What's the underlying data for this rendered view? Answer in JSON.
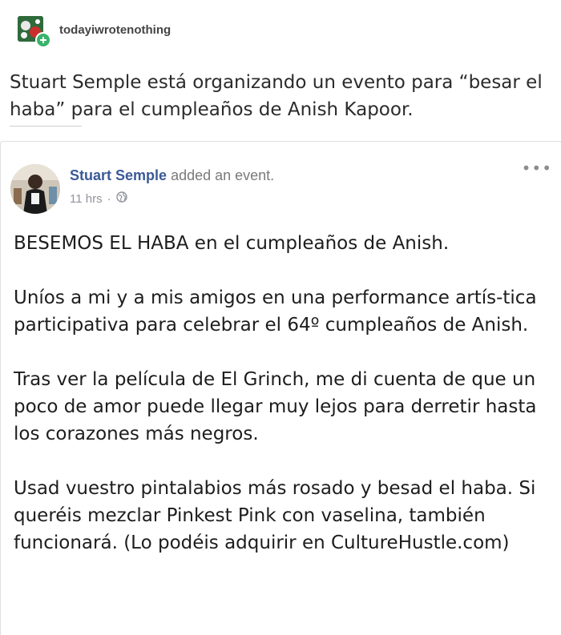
{
  "tumblr": {
    "username": "todayiwrotenothing",
    "caption": "Stuart Semple está organizando un evento para “besar el haba” para el cumpleaños de Anish Kapoor."
  },
  "facebook_post": {
    "author_name": "Stuart Semple",
    "action_text": "added an event.",
    "timestamp": "11 hrs",
    "separator": "·",
    "privacy_icon": "globe-icon",
    "more_icon": "more-options-icon",
    "more_glyph": "•••",
    "paragraphs": [
      "BESEMOS EL HABA en el cumpleaños de Anish.",
      "Uníos a mi y a mis amigos en una performance artís-tica participativa para celebrar el 64º cumpleaños de Anish.",
      "Tras ver la película de El Grinch, me di cuenta de que un poco de amor puede llegar muy lejos para derretir hasta los corazones más negros.",
      "Usad vuestro pintalabios más rosado y besad el haba. Si queréis mezclar Pinkest Pink con vaselina, también funcionará. (Lo podéis adquirir en CultureHustle.com)"
    ]
  },
  "colors": {
    "fb_name": "#3b5998",
    "fb_meta": "#90949c",
    "tumblr_badge": "#38b36a"
  }
}
